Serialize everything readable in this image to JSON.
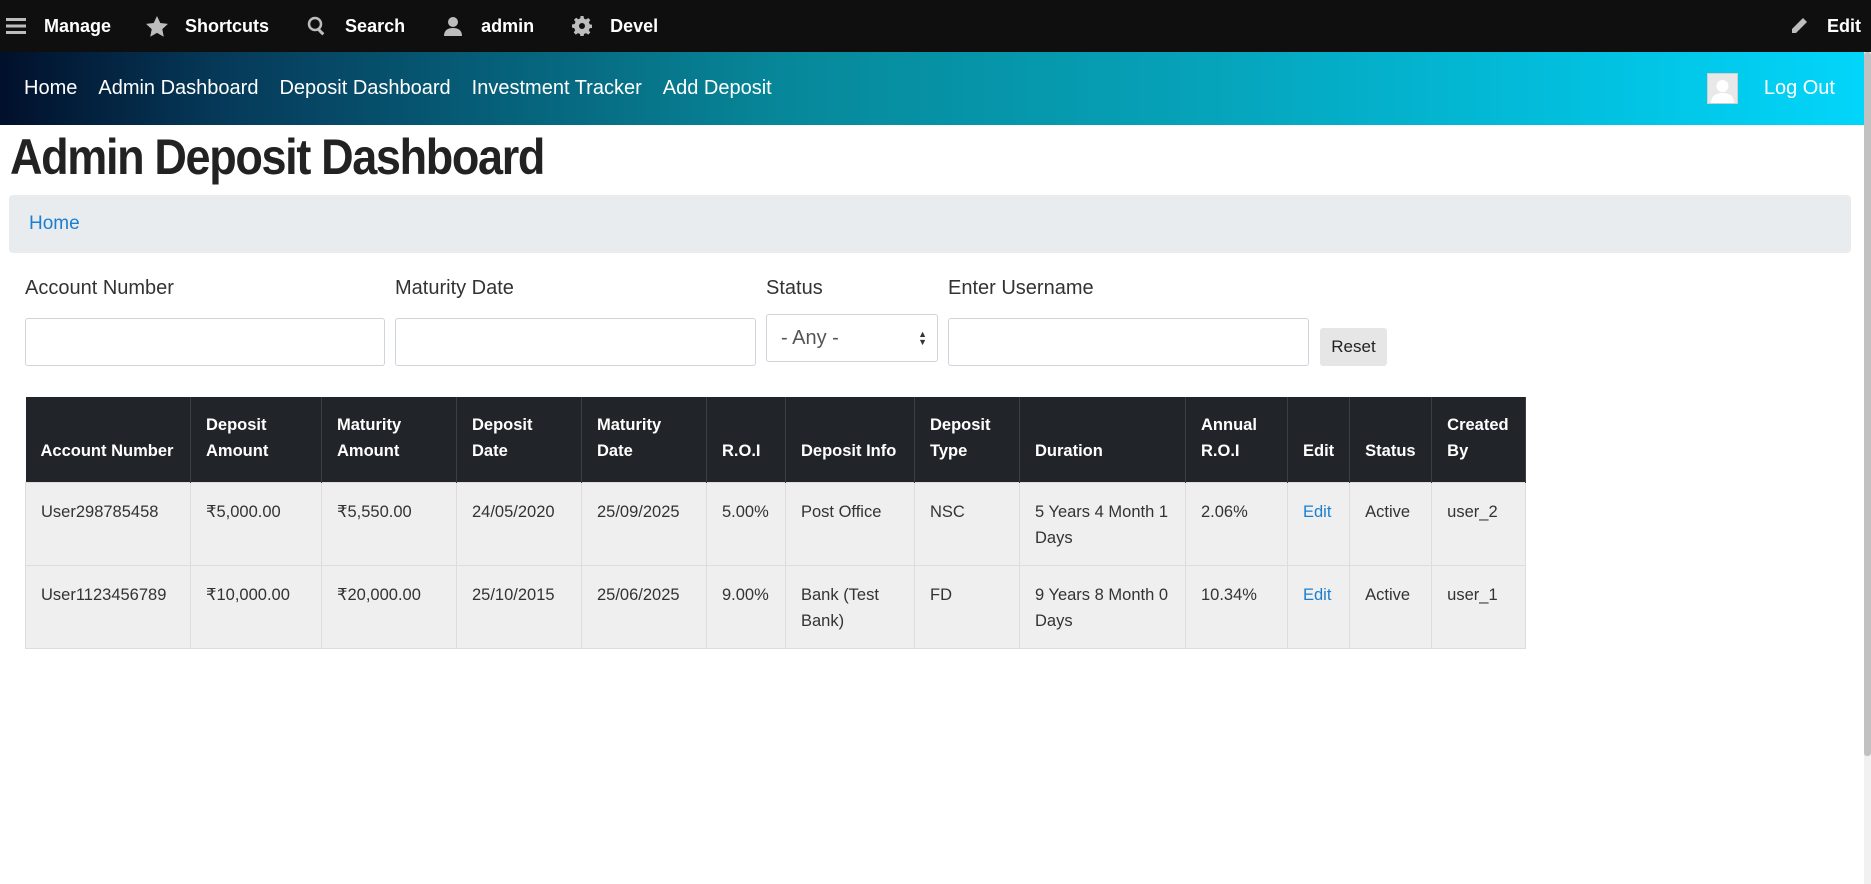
{
  "toolbar": {
    "manage": "Manage",
    "shortcuts": "Shortcuts",
    "search": "Search",
    "user": "admin",
    "devel": "Devel",
    "edit": "Edit"
  },
  "nav": {
    "links": [
      "Home",
      "Admin Dashboard",
      "Deposit Dashboard",
      "Investment Tracker",
      "Add Deposit"
    ],
    "logout": "Log Out"
  },
  "page": {
    "title": "Admin Deposit Dashboard",
    "breadcrumb": "Home"
  },
  "filters": {
    "account_label": "Account Number",
    "account_value": "",
    "maturity_label": "Maturity Date",
    "maturity_value": "",
    "status_label": "Status",
    "status_selected": "- Any -",
    "username_label": "Enter Username",
    "username_value": "",
    "reset": "Reset"
  },
  "table": {
    "headers": [
      "Account Number",
      "Deposit Amount",
      "Maturity Amount",
      "Deposit Date",
      "Maturity Date",
      "R.O.I",
      "Deposit Info",
      "Deposit Type",
      "Duration",
      "Annual R.O.I",
      "Edit",
      "Status",
      "Created By"
    ],
    "rows": [
      {
        "account": "User298785458",
        "deposit_amount": "₹5,000.00",
        "maturity_amount": "₹5,550.00",
        "deposit_date": "24/05/2020",
        "maturity_date": "25/09/2025",
        "roi": "5.00%",
        "info": "Post Office",
        "type": "NSC",
        "duration": "5 Years 4 Month 1 Days",
        "annual_roi": "2.06%",
        "edit": "Edit",
        "status": "Active",
        "created_by": "user_2"
      },
      {
        "account": "User1123456789",
        "deposit_amount": "₹10,000.00",
        "maturity_amount": "₹20,000.00",
        "deposit_date": "25/10/2015",
        "maturity_date": "25/06/2025",
        "roi": "9.00%",
        "info": "Bank (Test Bank)",
        "type": "FD",
        "duration": "9 Years 8 Month 0 Days",
        "annual_roi": "10.34%",
        "edit": "Edit",
        "status": "Active",
        "created_by": "user_1"
      }
    ]
  },
  "colors": {
    "toolbar_bg": "#0f0f0f",
    "nav_gradient_start": "#01102b",
    "nav_gradient_end": "#02d6fb",
    "link": "#1a7fd1",
    "table_header_bg": "#212529"
  }
}
